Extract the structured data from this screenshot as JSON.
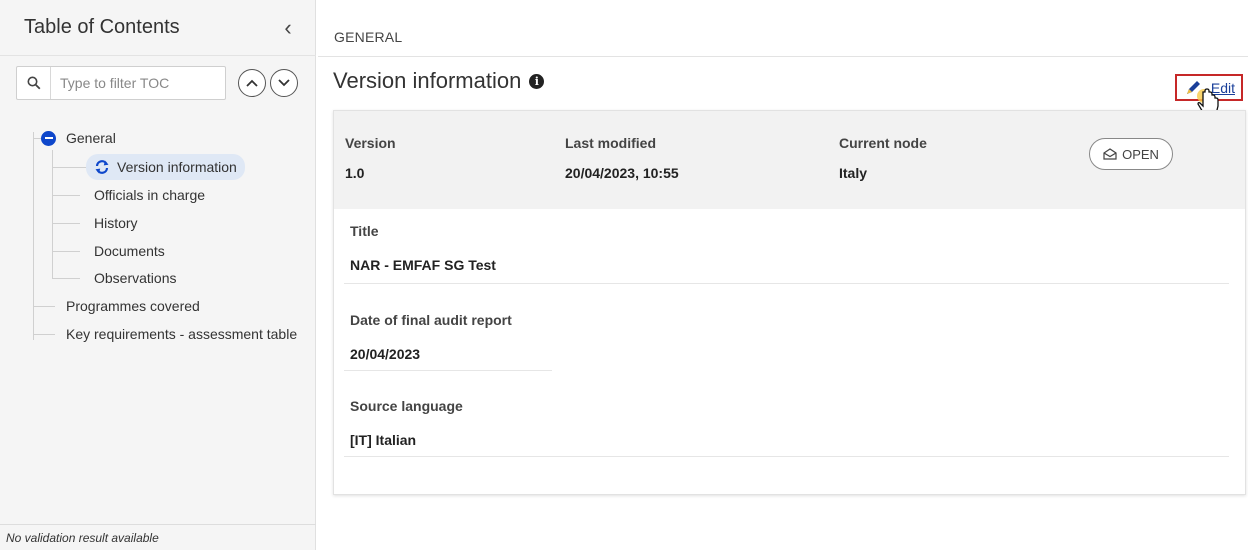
{
  "sidebar": {
    "title": "Table of Contents",
    "collapse_icon": "chevron-left-icon",
    "filter_placeholder": "Type to filter TOC",
    "tree": {
      "general": "General",
      "version_information": "Version information",
      "officials_in_charge": "Officials in charge",
      "history": "History",
      "documents": "Documents",
      "observations": "Observations",
      "programmes_covered": "Programmes covered",
      "key_requirements": "Key requirements - assessment table"
    },
    "validation_status": "No validation result available"
  },
  "main": {
    "breadcrumb": "GENERAL",
    "title": "Version information",
    "edit_label": "Edit",
    "summary": {
      "version_label": "Version",
      "version_value": "1.0",
      "last_modified_label": "Last modified",
      "last_modified_value": "20/04/2023, 10:55",
      "current_node_label": "Current node",
      "current_node_value": "Italy",
      "status_badge": "OPEN"
    },
    "fields": {
      "title_label": "Title",
      "title_value": "NAR - EMFAF SG Test",
      "date_label": "Date of final audit report",
      "date_value": "20/04/2023",
      "language_label": "Source language",
      "language_value": "[IT] Italian"
    }
  },
  "colors": {
    "accent": "#0e47cb",
    "edit_border": "#c62828",
    "active_item_bg": "#dfe8f5"
  }
}
